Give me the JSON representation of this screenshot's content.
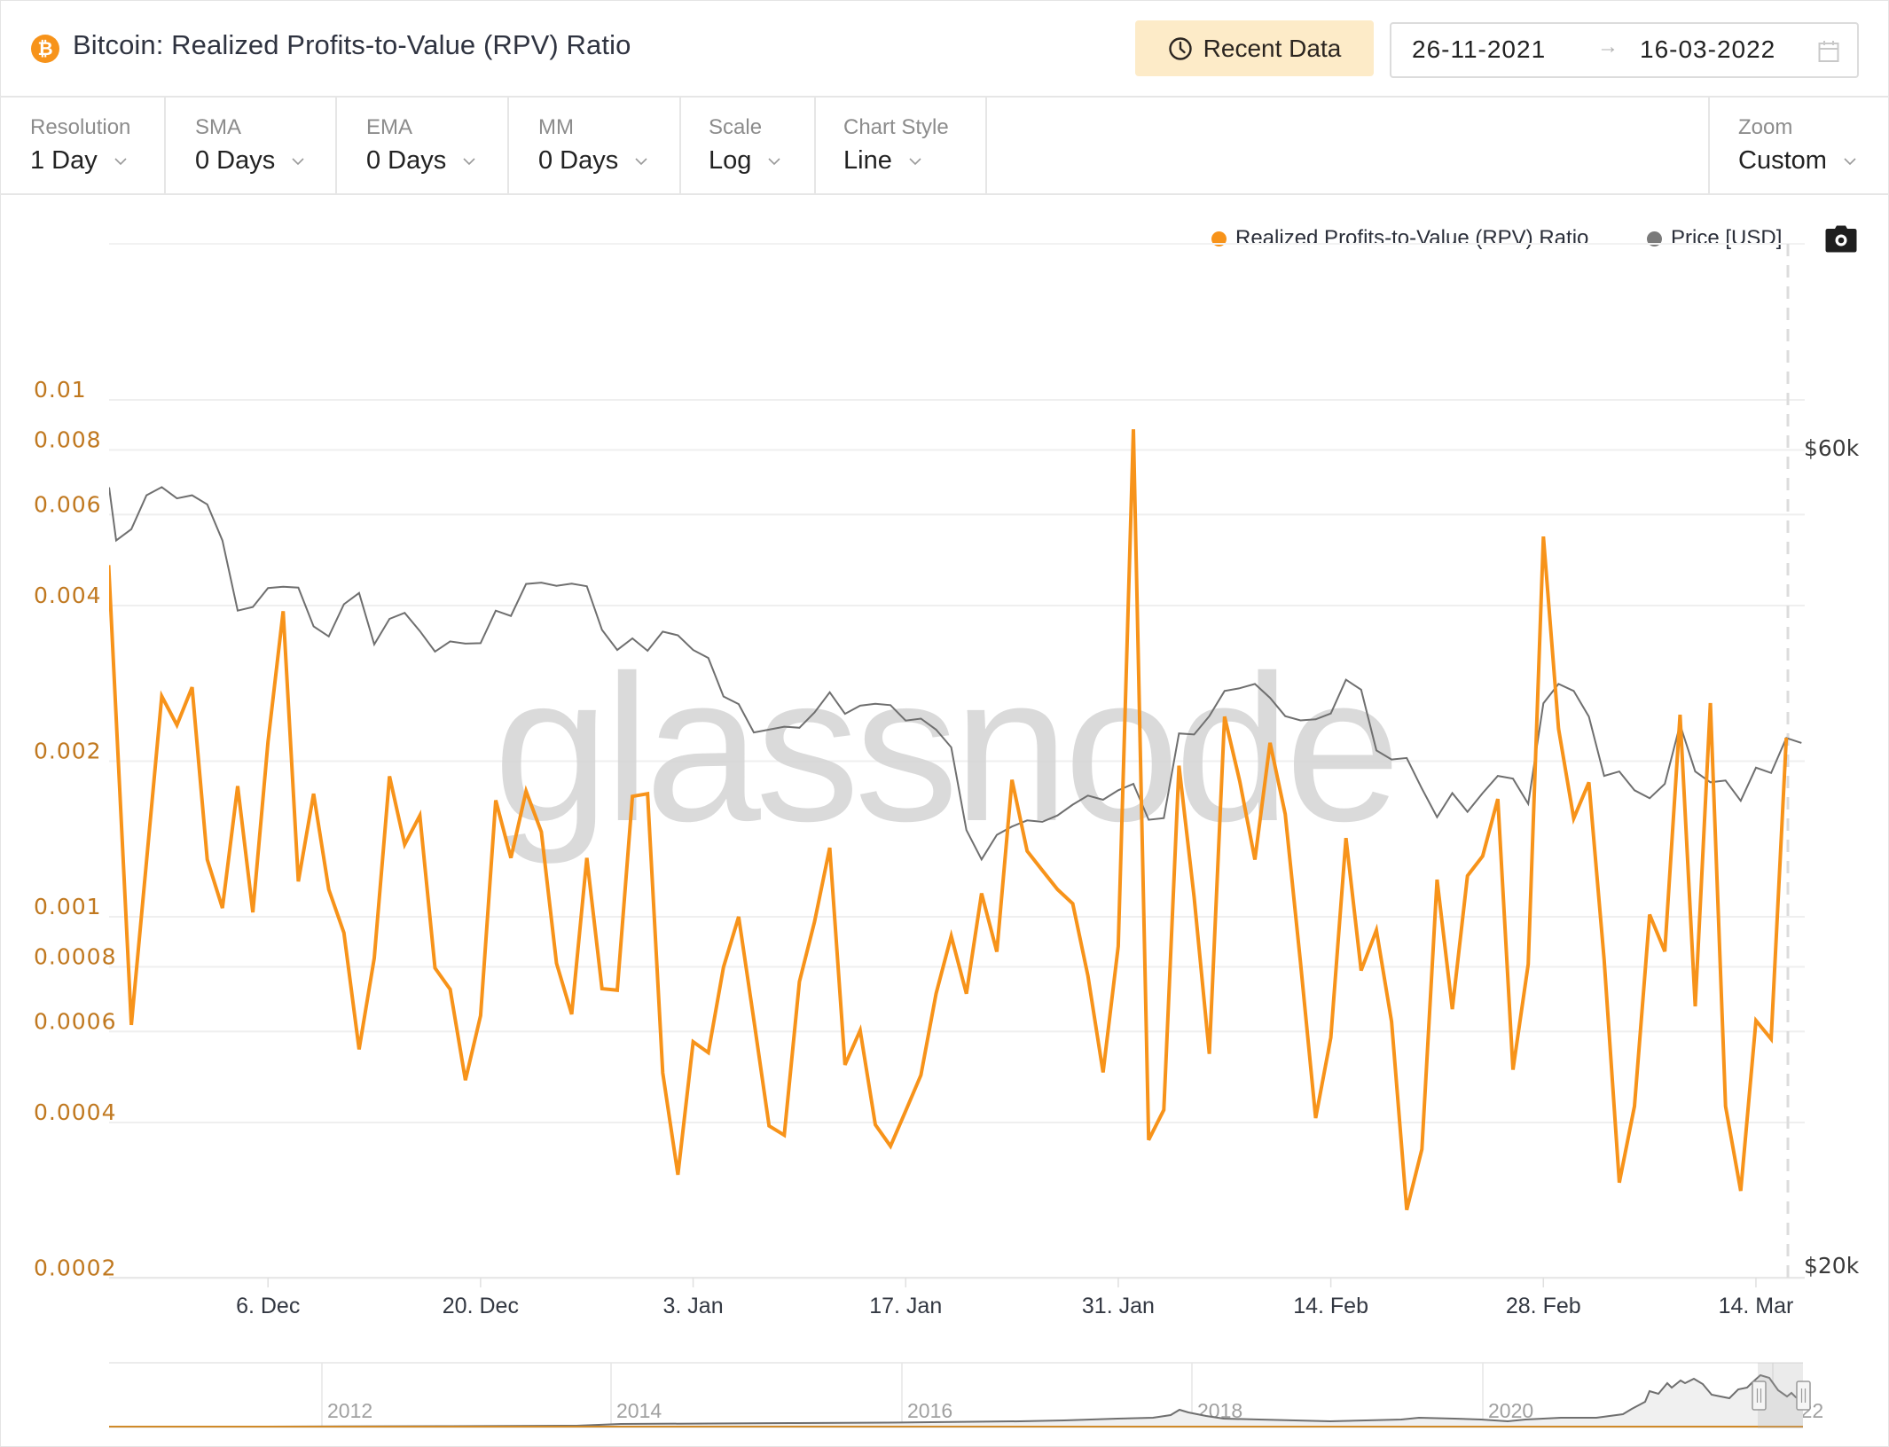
{
  "header": {
    "asset_icon": "bitcoin-icon",
    "asset_glyph": "₿",
    "title": "Bitcoin: Realized Profits-to-Value (RPV) Ratio",
    "recent_data_label": "Recent Data",
    "recent_data_icon": "clock-icon",
    "date_range": {
      "start": "26-11-2021",
      "arrow": "→",
      "end": "16-03-2022",
      "icon": "calendar-icon"
    }
  },
  "controls": [
    {
      "label": "Resolution",
      "value": "1 Day"
    },
    {
      "label": "SMA",
      "value": "0 Days"
    },
    {
      "label": "EMA",
      "value": "0 Days"
    },
    {
      "label": "MM",
      "value": "0 Days"
    },
    {
      "label": "Scale",
      "value": "Log"
    },
    {
      "label": "Chart Style",
      "value": "Line"
    }
  ],
  "zoom_control": {
    "label": "Zoom",
    "value": "Custom"
  },
  "colors": {
    "rpv": "#F7931A",
    "price": "#777777",
    "axis_left": "#C0781F",
    "accent_button": "#FDEBC8"
  },
  "legend": [
    {
      "name": "Realized Profits-to-Value (RPV) Ratio",
      "color": "#F7931A"
    },
    {
      "name": "Price [USD]",
      "color": "#7a7a7a"
    }
  ],
  "camera_icon": "camera-icon",
  "watermark": "glassnode",
  "chart_data": {
    "type": "line",
    "title": "Bitcoin: Realized Profits-to-Value (RPV) Ratio",
    "x_start_date": "2021-11-26",
    "x_end_date": "2022-03-16",
    "x_unit": "day",
    "x_tick_labels": [
      {
        "label": "6. Dec",
        "day": 10
      },
      {
        "label": "20. Dec",
        "day": 24
      },
      {
        "label": "3. Jan",
        "day": 38
      },
      {
        "label": "17. Jan",
        "day": 52
      },
      {
        "label": "31. Jan",
        "day": 66
      },
      {
        "label": "14. Feb",
        "day": 80
      },
      {
        "label": "28. Feb",
        "day": 94
      },
      {
        "label": "14. Mar",
        "day": 108
      }
    ],
    "y_left": {
      "label": "RPV Ratio",
      "scale": "log",
      "range": [
        0.0002,
        0.01
      ],
      "ticks": [
        "0.01",
        "0.008",
        "0.006",
        "0.004",
        "0.002",
        "0.001",
        "0.0008",
        "0.0006",
        "0.0004",
        "0.0002"
      ]
    },
    "y_right": {
      "label": "Price [USD]",
      "scale": "log",
      "range": [
        20000,
        60000
      ],
      "ticks": [
        {
          "label": "$60k",
          "value": 60000
        },
        {
          "label": "$20k",
          "value": 20000
        }
      ]
    },
    "grid": true,
    "legend_position": "top-right",
    "series": [
      {
        "name": "Realized Profits-to-Value (RPV) Ratio",
        "axis": "left",
        "values": [
          0.00479,
          0.000618,
          0.00128,
          0.00267,
          0.00235,
          0.00278,
          0.00129,
          0.00104,
          0.00179,
          0.00102,
          0.00218,
          0.0039,
          0.00117,
          0.00173,
          0.00113,
          0.000931,
          0.000554,
          0.000832,
          0.00187,
          0.00138,
          0.00157,
          0.000796,
          0.000724,
          0.000483,
          0.000644,
          0.00168,
          0.0013,
          0.00175,
          0.00146,
          0.000813,
          0.000648,
          0.0013,
          0.000726,
          0.000721,
          0.00171,
          0.00173,
          0.000499,
          0.000317,
          0.000573,
          0.000546,
          0.000799,
          0.001,
          0.000632,
          0.000394,
          0.000378,
          0.000749,
          0.000979,
          0.00136,
          0.000517,
          0.000603,
          0.000396,
          0.00036,
          0.000421,
          0.000494,
          0.00071,
          0.000918,
          0.00071,
          0.00111,
          0.000856,
          0.00184,
          0.00134,
          0.00123,
          0.00113,
          0.00106,
          0.000769,
          0.0005,
          0.000877,
          0.00877,
          0.00037,
          0.000423,
          0.00196,
          0.00109,
          0.000543,
          0.00244,
          0.00183,
          0.00129,
          0.00217,
          0.00158,
          0.000816,
          0.000408,
          0.000584,
          0.00142,
          0.000787,
          0.000942,
          0.000627,
          0.000271,
          0.000355,
          0.00118,
          0.000663,
          0.0012,
          0.00131,
          0.00169,
          0.000506,
          0.00081,
          0.00544,
          0.00231,
          0.00155,
          0.00182,
          0.000826,
          0.000306,
          0.00043,
          0.00101,
          0.000857,
          0.00246,
          0.000671,
          0.00259,
          0.00043,
          0.000295,
          0.00063,
          0.00058,
          0.00222
        ]
      },
      {
        "name": "Price [USD]",
        "axis": "right",
        "values": [
          52970,
          53780,
          56290,
          56910,
          56050,
          56290,
          55600,
          52970,
          48200,
          48440,
          49690,
          49780,
          49720,
          47190,
          46560,
          48620,
          49360,
          46060,
          47670,
          48060,
          46900,
          45620,
          46250,
          46110,
          46140,
          48200,
          47860,
          49960,
          50050,
          49840,
          49980,
          49810,
          46970,
          45720,
          46440,
          45670,
          46860,
          46630,
          45720,
          45230,
          42950,
          42510,
          40920,
          41080,
          41240,
          41180,
          42040,
          43190,
          41960,
          42420,
          42530,
          42450,
          41580,
          41690,
          41080,
          40110,
          35890,
          34500,
          35660,
          36060,
          36360,
          36290,
          36600,
          37140,
          37590,
          37380,
          37860,
          38190,
          36390,
          36470,
          40870,
          40810,
          41830,
          43270,
          43430,
          43680,
          42870,
          41830,
          41590,
          41650,
          41980,
          43930,
          43340,
          39950,
          39460,
          39540,
          37950,
          36520,
          37720,
          36780,
          37720,
          38600,
          38460,
          37180,
          42560,
          43680,
          43270,
          41800,
          38600,
          38830,
          37860,
          37460,
          38190,
          41360,
          38830,
          38270,
          38360,
          37330,
          39030,
          38750,
          40620,
          40350
        ]
      }
    ],
    "navigator": {
      "year_labels": [
        "2012",
        "2014",
        "2016",
        "2018",
        "2020",
        "2022"
      ],
      "selected_range": [
        "26-11-2021",
        "16-03-2022"
      ]
    }
  }
}
